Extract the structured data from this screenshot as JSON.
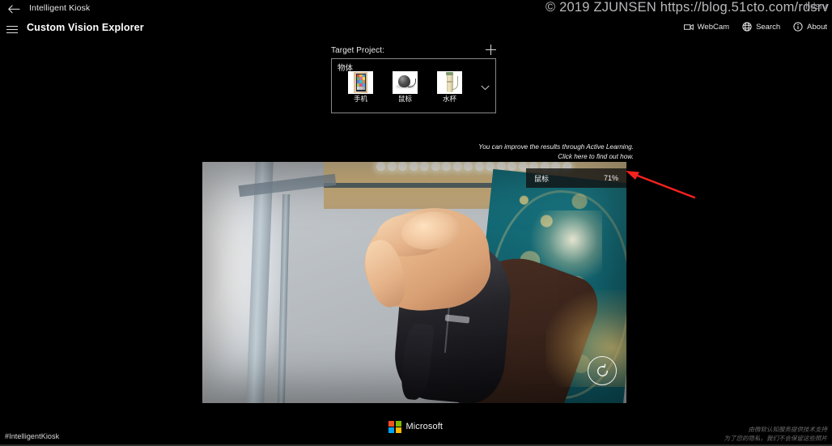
{
  "titlebar": {
    "back_icon": "back-arrow-icon",
    "app_title": "Intelligent Kiosk"
  },
  "commandbar": {
    "menu_icon": "hamburger-menu-icon",
    "page_title": "Custom Vision Explorer",
    "nav": [
      {
        "label": "WebCam",
        "icon": "webcam-icon"
      },
      {
        "label": "Search",
        "icon": "globe-icon"
      },
      {
        "label": "About",
        "icon": "info-icon"
      }
    ]
  },
  "watermark": {
    "line": "© 2019 ZJUNSEN https://blog.51cto.com/rdsrv",
    "overlay": "hdsrv"
  },
  "target_project": {
    "label": "Target Project:",
    "add_icon": "plus-icon",
    "expand_icon": "chevron-down-icon",
    "project_name": "物体",
    "tags": [
      {
        "caption": "手机",
        "thumb": "phone-thumbnail"
      },
      {
        "caption": "鼠标",
        "thumb": "mouse-thumbnail"
      },
      {
        "caption": "水杯",
        "thumb": "cup-thumbnail"
      }
    ]
  },
  "hint": {
    "line1": "You can improve the results through Active Learning.",
    "line2": "Click here to find out how."
  },
  "camera": {
    "prediction": {
      "label": "鼠标",
      "score": "71%"
    },
    "refresh_icon": "rotate-ccw-icon",
    "annotation_icon": "red-arrow-icon"
  },
  "footer": {
    "hashtag": "#IntelligentKiosk",
    "brand": "Microsoft",
    "brand_colors": {
      "top_left": "#f25022",
      "top_right": "#7fba00",
      "bottom_left": "#00a4ef",
      "bottom_right": "#ffb900"
    },
    "legal_line1": "由微软认知服务提供技术支持",
    "legal_line2": "为了您的隐私，我们不会保留这些照片"
  },
  "theme": {
    "background": "#000000",
    "accent": "#ffffff",
    "annotation_red": "#f5221f",
    "panel_border": "#888888"
  }
}
